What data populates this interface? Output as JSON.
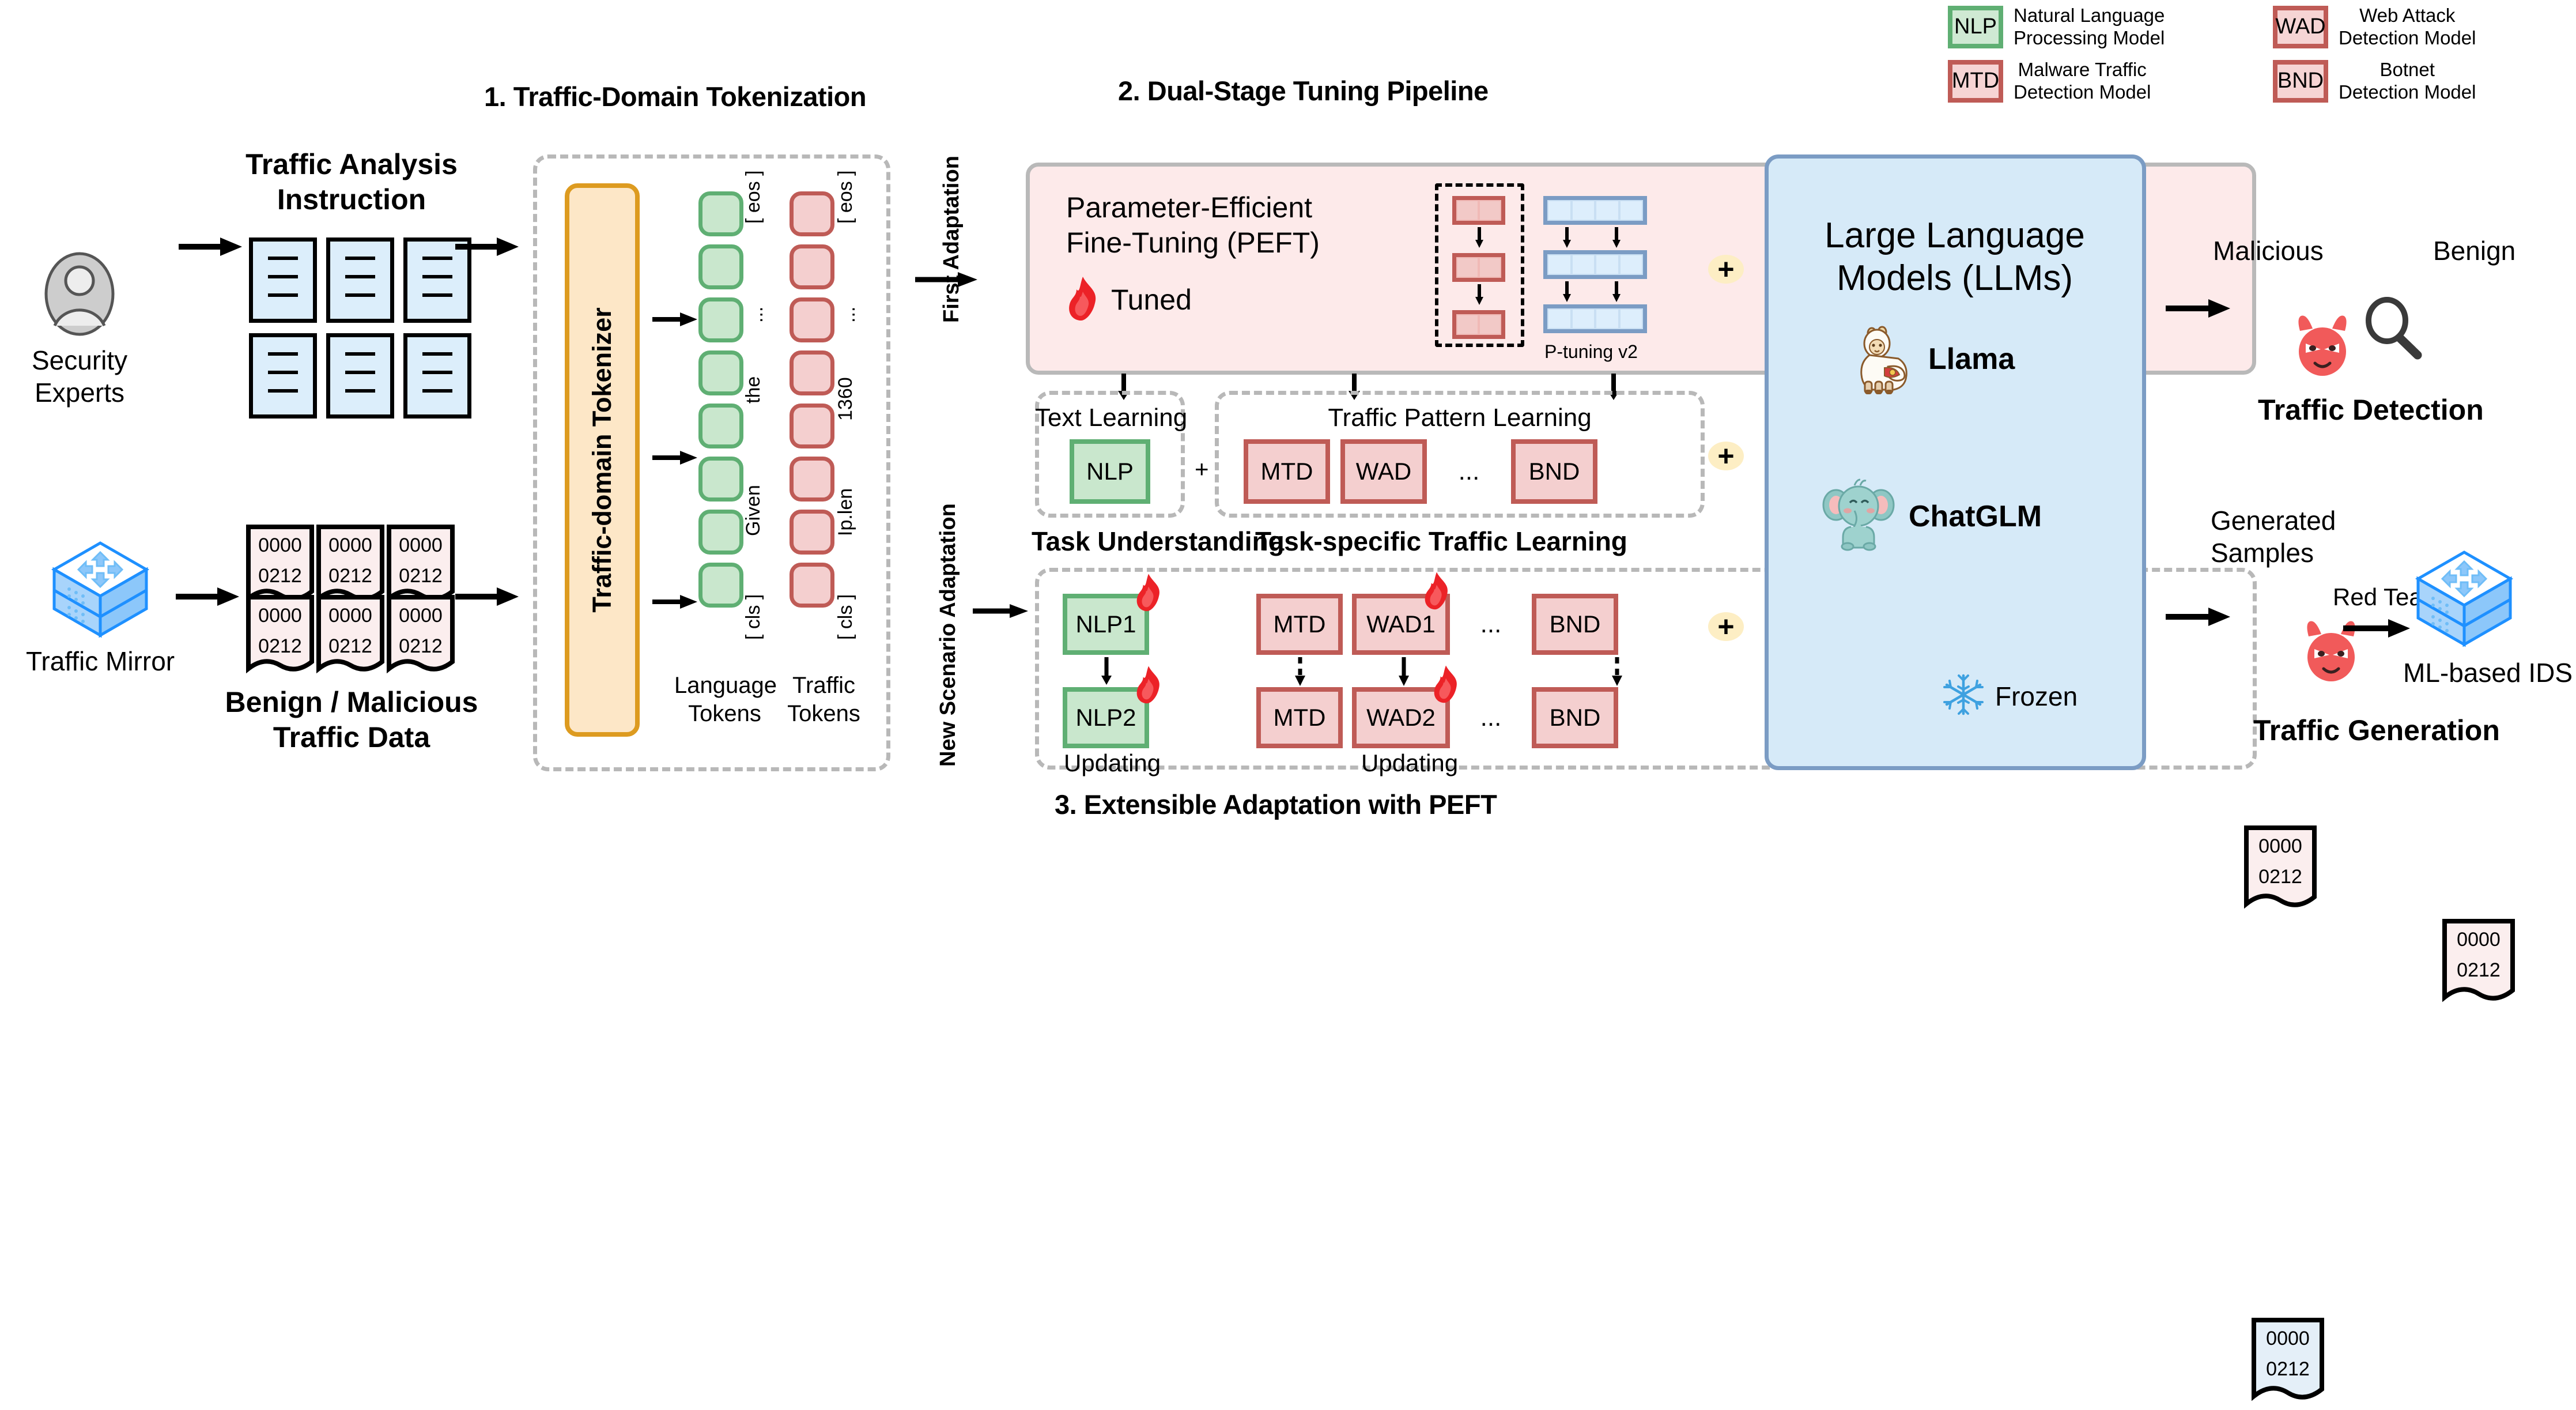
{
  "legend": {
    "items": [
      {
        "code": "NLP",
        "desc_line1": "Natural Language",
        "desc_line2": "Processing Model",
        "color": "#5faf73",
        "fill": "#cfe9d3"
      },
      {
        "code": "WAD",
        "desc_line1": "Web Attack",
        "desc_line2": "Detection Model",
        "color": "#bf5b56",
        "fill": "#f6d4d4"
      },
      {
        "code": "MTD",
        "desc_line1": "Malware Traffic",
        "desc_line2": "Detection Model",
        "color": "#bf5b56",
        "fill": "#f6d4d4"
      },
      {
        "code": "BND",
        "desc_line1": "Botnet",
        "desc_line2": "Detection Model",
        "color": "#bf5b56",
        "fill": "#f6d4d4"
      }
    ]
  },
  "section_titles": {
    "one": "1. Traffic-Domain Tokenization",
    "two": "2. Dual-Stage Tuning Pipeline",
    "three": "3. Extensible Adaptation with PEFT"
  },
  "inputs": {
    "expert_label_line1": "Security",
    "expert_label_line2": "Experts",
    "instruction_title_line1": "Traffic Analysis",
    "instruction_title_line2": "Instruction",
    "mirror_label": "Traffic Mirror",
    "traffic_title_line1": "Benign / Malicious",
    "traffic_title_line2": "Traffic Data",
    "packet_line1": "0000",
    "packet_line2": "0212"
  },
  "tokenization": {
    "tokenizer_label": "Traffic-domain Tokenizer",
    "language_col_label_line1": "Language",
    "language_col_label_line2": "Tokens",
    "traffic_col_label_line1": "Traffic",
    "traffic_col_label_line2": "Tokens",
    "language_tokens": [
      "[ cls ]",
      "Given",
      "the",
      "...",
      "[ eos ]"
    ],
    "traffic_tokens": [
      "[ cls ]",
      "Ip.len",
      "1360",
      "...",
      "[ eos ]"
    ],
    "token_count": 8
  },
  "pipeline": {
    "first_adaptation_label": "First Adaptation",
    "new_scenario_label": "New Scenario Adaptation",
    "peft_title_line1": "Parameter-Efficient",
    "peft_title_line2": "Fine-Tuning (PEFT)",
    "tuned_label": "Tuned",
    "ptuning_label": "P-tuning v2",
    "text_learning_label": "Text Learning",
    "traffic_pattern_label": "Traffic Pattern Learning",
    "plus_small": "+",
    "task_understanding_label": "Task Understanding",
    "task_specific_label": "Task-specific Traffic Learning",
    "stage1_text_models": [
      "NLP"
    ],
    "stage1_traffic_models": [
      "MTD",
      "WAD",
      "...",
      "BND"
    ],
    "stage2_text_models": [
      "NLP1",
      "NLP2"
    ],
    "stage2_traffic_row1": [
      "MTD",
      "WAD1",
      "...",
      "BND"
    ],
    "stage2_traffic_row2": [
      "MTD",
      "WAD2",
      "...",
      "BND"
    ],
    "updating_label_left": "Updating",
    "updating_label_right": "Updating",
    "plus_badges": [
      "+",
      "+",
      "+"
    ]
  },
  "llm": {
    "title_line1": "Large Language",
    "title_line2": "Models (LLMs)",
    "models": [
      {
        "name": "Llama",
        "icon": "llama-icon"
      },
      {
        "name": "ChatGLM",
        "icon": "elephant-icon"
      }
    ],
    "frozen_label": "Frozen"
  },
  "outputs": {
    "detection": {
      "malicious_label": "Malicious",
      "benign_label": "Benign",
      "packet_line1": "0000",
      "packet_line2": "0212",
      "title": "Traffic Detection"
    },
    "generation": {
      "generated_label_line1": "Generated",
      "generated_label_line2": "Samples",
      "packet_line1": "0000",
      "packet_line2": "0212",
      "red_teaming_label": "Red Teaming",
      "ids_label": "ML-based IDS",
      "title": "Traffic Generation"
    }
  },
  "colors": {
    "green_border": "#5faf73",
    "green_fill": "#c9e7cd",
    "red_border": "#bf5b56",
    "red_fill": "#f4cfcf",
    "blue_border": "#7b9cc4",
    "blue_fill": "#d6eaf8",
    "orange_border": "#dd9b20",
    "orange_fill": "#fde7c7",
    "peft_fill": "#fdeaea",
    "plus_fill": "#fdeec4",
    "dashed_gray": "#b8b8b8",
    "flame_red": "#ec2227",
    "snowflake_blue": "#3ea1e0"
  }
}
